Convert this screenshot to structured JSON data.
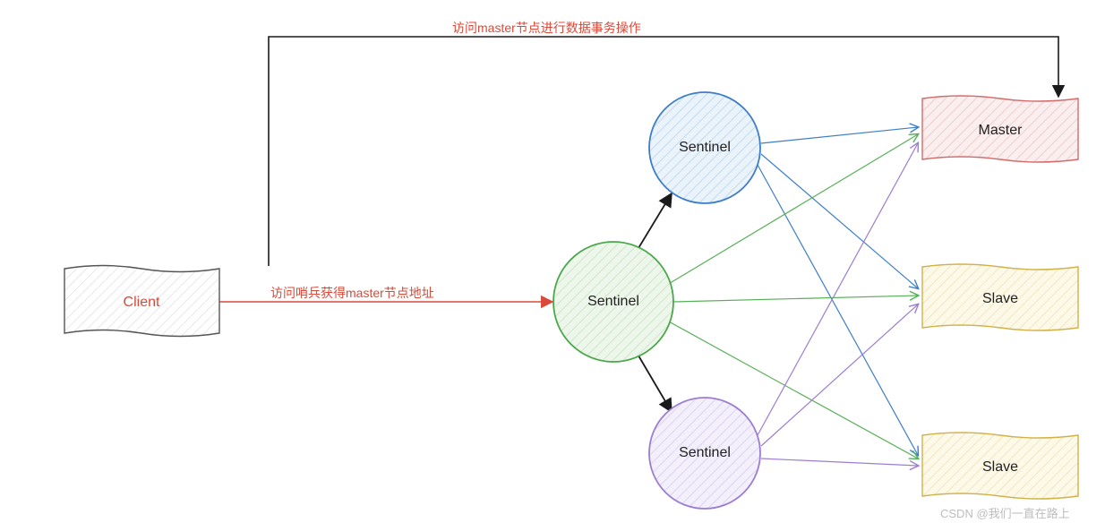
{
  "diagram": {
    "client": {
      "label": "Client",
      "color": "#d94a3a"
    },
    "sentinel1": {
      "label": "Sentinel",
      "color": "#1f6fc0",
      "fill": "#cfe3f4"
    },
    "sentinel2": {
      "label": "Sentinel",
      "color": "#3c9a3c",
      "fill": "#e4f2df"
    },
    "sentinel3": {
      "label": "Sentinel",
      "color": "#8a62c6",
      "fill": "#ede6f7"
    },
    "master": {
      "label": "Master",
      "color": "#d26b6b",
      "fill": "#f6e4e4"
    },
    "slave1": {
      "label": "Slave",
      "color": "#d1b24a",
      "fill": "#faf4df"
    },
    "slave2": {
      "label": "Slave",
      "color": "#d1b24a",
      "fill": "#faf4df"
    }
  },
  "labels": {
    "top": "访问master节点进行数据事务操作",
    "middle": "访问哨兵获得master节点地址"
  },
  "watermark": "CSDN @我们一直在路上"
}
